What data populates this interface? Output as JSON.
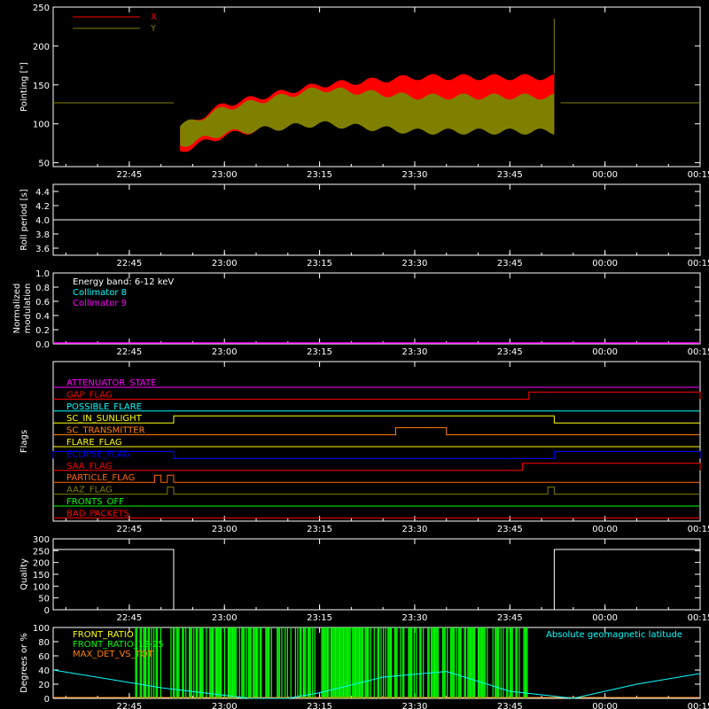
{
  "colors": {
    "background": "#000000",
    "axes": "#ffffff",
    "red": "#ff0000",
    "olive": "#808000",
    "cyan": "#00ffff",
    "magenta": "#ff00ff",
    "green": "#00ff00",
    "yellow": "#ffff00",
    "orange": "#ff8000",
    "blue": "#0000ff",
    "darkorange": "#ff6600"
  },
  "time_axis": {
    "tick_labels": [
      "22:45",
      "23:00",
      "23:15",
      "23:30",
      "23:45",
      "00:00",
      "00:15"
    ],
    "start": "22:33",
    "end": "00:15"
  },
  "chart_data": [
    {
      "type": "line",
      "panel": "pointing",
      "ylabel": "Pointing [\"]",
      "ylim": [
        45,
        250
      ],
      "y_ticks": [
        50,
        100,
        150,
        200,
        250
      ],
      "legend": [
        "X",
        "Y"
      ],
      "legend_placement": "top-left",
      "series": [
        {
          "name": "X",
          "color": "#ff0000",
          "t": [
            "22:33",
            "22:52",
            "22:53",
            "23:00",
            "23:15",
            "23:30",
            "23:45",
            "23:52",
            "23:53",
            "00:15"
          ],
          "upper": [
            127,
            127,
            95,
            125,
            150,
            160,
            160,
            160,
            127,
            127
          ],
          "lower": [
            127,
            127,
            65,
            85,
            105,
            95,
            95,
            95,
            127,
            127
          ]
        },
        {
          "name": "Y",
          "color": "#808000",
          "t": [
            "22:33",
            "22:52",
            "22:53",
            "23:00",
            "23:15",
            "23:30",
            "23:45",
            "23:52",
            "23:53",
            "00:15"
          ],
          "upper": [
            127,
            127,
            97,
            120,
            145,
            135,
            135,
            135,
            127,
            127
          ],
          "lower": [
            127,
            127,
            72,
            88,
            100,
            90,
            90,
            90,
            127,
            127
          ]
        }
      ]
    },
    {
      "type": "line",
      "panel": "roll",
      "ylabel": "Roll period [s]",
      "ylim": [
        3.5,
        4.5
      ],
      "y_tick_labels": [
        "3.6",
        "3.8",
        "4.0",
        "4.2",
        "4.4"
      ],
      "series": [
        {
          "t": [
            "22:33",
            "00:15"
          ],
          "values": [
            4.0,
            4.0
          ],
          "color": "#ffffff"
        }
      ]
    },
    {
      "type": "line",
      "panel": "modulation",
      "ylabel": "Normalized modulation",
      "ylim": [
        0,
        1
      ],
      "y_tick_labels": [
        "0.0",
        "0.2",
        "0.4",
        "0.6",
        "0.8",
        "1.0"
      ],
      "legend": [
        "Energy band: 6-12 keV",
        "Collimator 8",
        "Collimator 9"
      ],
      "series": [
        {
          "name": "Collimator 9",
          "t": [
            "22:33",
            "00:15"
          ],
          "values": [
            0,
            0
          ],
          "color": "#ff00ff"
        }
      ]
    },
    {
      "type": "line",
      "panel": "flags",
      "ylabel": "Flags",
      "flags": [
        {
          "name": "ATTENUATOR_STATE",
          "color": "#ff00ff",
          "highs": []
        },
        {
          "name": "GAP_FLAG",
          "color": "#ff0000",
          "highs": [
            [
              "23:48",
              "00:15"
            ]
          ]
        },
        {
          "name": "POSSIBLE_FLARE",
          "color": "#00ffff",
          "highs": []
        },
        {
          "name": "SC_IN_SUNLIGHT",
          "color": "#ffff00",
          "highs": [
            [
              "22:52",
              "23:52"
            ]
          ]
        },
        {
          "name": "SC_TRANSMITTER",
          "color": "#ff8000",
          "highs": [
            [
              "23:27",
              "23:35"
            ]
          ]
        },
        {
          "name": "FLARE_FLAG",
          "color": "#ffff00",
          "highs": []
        },
        {
          "name": "ECLIPSE_FLAG",
          "color": "#0000ff",
          "highs": [
            [
              "22:33",
              "22:52"
            ],
            [
              "23:52",
              "00:15"
            ]
          ]
        },
        {
          "name": "SAA_FLAG",
          "color": "#ff0000",
          "highs": [
            [
              "23:47",
              "00:15"
            ]
          ]
        },
        {
          "name": "PARTICLE_FLAG",
          "color": "#ff6600",
          "highs": [
            [
              "22:49",
              "22:50"
            ],
            [
              "22:51",
              "22:52"
            ]
          ]
        },
        {
          "name": "AAZ_FLAG",
          "color": "#808000",
          "highs": [
            [
              "22:51",
              "22:52"
            ],
            [
              "23:51",
              "23:52"
            ]
          ]
        },
        {
          "name": "FRONTS_OFF",
          "color": "#00ff00",
          "highs": []
        },
        {
          "name": "BAD_PACKETS",
          "color": "#ff0000",
          "highs": []
        }
      ]
    },
    {
      "type": "line",
      "panel": "quality",
      "ylabel": "Quality",
      "ylim": [
        0,
        300
      ],
      "y_tick_labels": [
        "0",
        "50",
        "100",
        "150",
        "200",
        "250",
        "300"
      ],
      "series": [
        {
          "t": [
            "22:33",
            "22:52",
            "22:52",
            "23:52",
            "23:52",
            "00:15"
          ],
          "values": [
            255,
            255,
            0,
            0,
            255,
            255
          ],
          "color": "#ffffff"
        }
      ]
    },
    {
      "type": "line",
      "panel": "ratios",
      "ylabel": "Degrees or %",
      "ylim": [
        0,
        100
      ],
      "y_tick_labels": [
        "0",
        "20",
        "40",
        "60",
        "80",
        "100"
      ],
      "legend": [
        "FRONT_RATIO",
        "FRONT_RATIO_12-25",
        "MAX_DET_VS_TOT",
        "Absolute geomagnetic latitude"
      ],
      "series": [
        {
          "name": "FRONT_RATIO",
          "color": "#00ff00",
          "t_range": [
            "22:46",
            "23:48"
          ],
          "values": "dense vertical bars 0-100"
        },
        {
          "name": "Absolute geomagnetic latitude",
          "color": "#00ffff",
          "t": [
            "22:33",
            "22:50",
            "23:04",
            "23:10",
            "23:15",
            "23:25",
            "23:35",
            "23:45",
            "23:55",
            "00:05",
            "00:15"
          ],
          "values": [
            40,
            15,
            0,
            0,
            8,
            30,
            38,
            10,
            0,
            20,
            35
          ]
        }
      ]
    }
  ]
}
